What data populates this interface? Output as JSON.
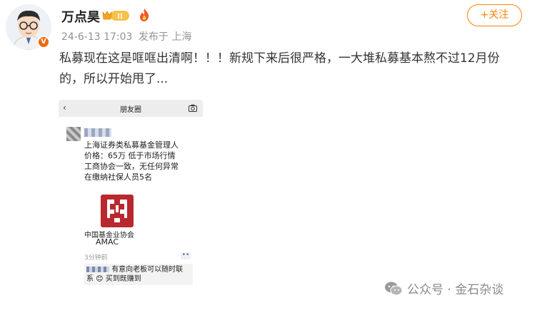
{
  "author": {
    "name": "万点昊",
    "vip_level": "II",
    "verified_mark": "V",
    "timestamp": "24-6-13 17:03",
    "source": "发布于 上海"
  },
  "actions": {
    "follow_label": "+关注"
  },
  "post": {
    "text": "私募现在这是哐哐出清啊！！！新规下来后很严格，一大堆私募基本熬不过12月份的，所以开始甩了..."
  },
  "screenshot": {
    "back": "‹",
    "title": "朋友圈",
    "line1": "上海证券类私募基金管理人",
    "line2": "价格：65万 低于市场行情",
    "line3": "工商协会一致，无任何异常",
    "line4": "在缴纳社保人员5名",
    "logo_cn": "中国基金业协会",
    "logo_en": "AMAC",
    "time": "3分钟前",
    "more": "••",
    "comment_line1": "有意向老板可以随时联",
    "comment_line2": "系 😊 买到既赚到"
  },
  "watermark": {
    "text": "公众号 · 金石杂谈"
  },
  "colors": {
    "accent": "#ff8200",
    "amac_red": "#b8282e",
    "verified": "#f06b0c"
  }
}
